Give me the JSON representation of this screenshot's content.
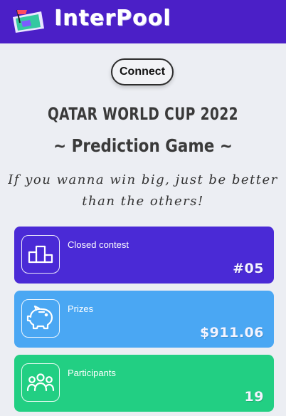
{
  "header": {
    "brand": "InterPool",
    "logo_icon": "pitch-flag-icon",
    "background": "#4b1fc7"
  },
  "connect_button": {
    "label": "Connect"
  },
  "hero": {
    "title_line1": "QATAR WORLD CUP 2022",
    "title_line2": "~ Prediction Game ~",
    "tagline_line1": "If you wanna win big, just be better",
    "tagline_line2": "than the others!"
  },
  "cards": [
    {
      "label": "Closed contest",
      "value": "#05",
      "icon": "podium-icon",
      "color": "#4a2ad6"
    },
    {
      "label": "Prizes",
      "value": "$911.06",
      "icon": "piggy-bank-icon",
      "color": "#4aa7f3"
    },
    {
      "label": "Participants",
      "value": "19",
      "icon": "users-group-icon",
      "color": "#22cf83"
    }
  ]
}
